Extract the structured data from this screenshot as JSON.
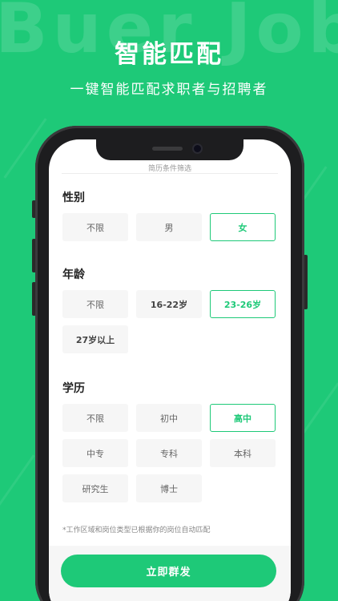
{
  "background": {
    "watermark": "Buer Job",
    "accent": "#1ec978"
  },
  "hero": {
    "title": "智能匹配",
    "subtitle": "一键智能匹配求职者与招聘者"
  },
  "screen": {
    "header": "简历条件筛选",
    "gender": {
      "title": "性别",
      "options": [
        {
          "label": "不限",
          "selected": false
        },
        {
          "label": "男",
          "selected": false
        },
        {
          "label": "女",
          "selected": true
        }
      ]
    },
    "age": {
      "title": "年龄",
      "options": [
        {
          "label": "不限",
          "selected": false
        },
        {
          "label": "16-22岁",
          "selected": false
        },
        {
          "label": "23-26岁",
          "selected": true
        },
        {
          "label": "27岁以上",
          "selected": false
        }
      ]
    },
    "education": {
      "title": "学历",
      "options": [
        {
          "label": "不限",
          "selected": false
        },
        {
          "label": "初中",
          "selected": false
        },
        {
          "label": "高中",
          "selected": true
        },
        {
          "label": "中专",
          "selected": false
        },
        {
          "label": "专科",
          "selected": false
        },
        {
          "label": "本科",
          "selected": false
        },
        {
          "label": "研究生",
          "selected": false
        },
        {
          "label": "博士",
          "selected": false
        }
      ]
    },
    "note": "*工作区域和岗位类型已根据你的岗位自动匹配",
    "submit_label": "立即群发"
  }
}
